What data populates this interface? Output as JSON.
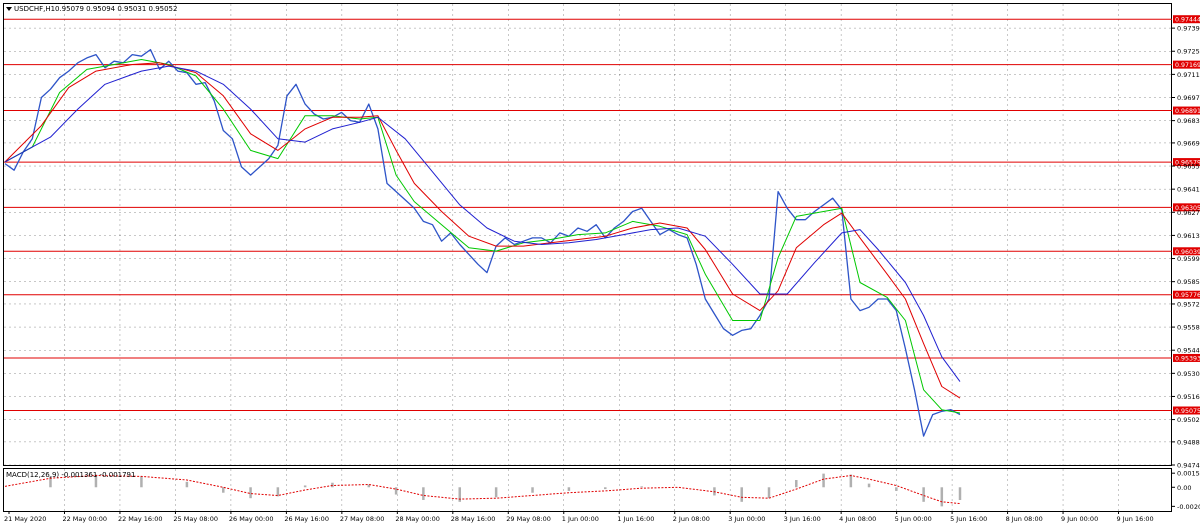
{
  "header": {
    "symbol_text": "USDCHF,H1",
    "ohlc_text": "0.95079 0.95094 0.95031 0.95052"
  },
  "macd": {
    "label_text": "MACD(12,26,9) -0.001361 -0.001791",
    "ticks": [
      "0.001547",
      "0.00",
      "-0.002058"
    ]
  },
  "colors": {
    "background": "#ffffff",
    "grid": "#000000",
    "price": "#2e54c8",
    "ma_green": "#00c800",
    "ma_red": "#e00000",
    "ma_blue": "#2020d0",
    "level_line": "#e00000",
    "level_label_bg": "#e00000",
    "macd_hist": "#b0b0b0",
    "macd_signal": "#e00000"
  },
  "chart_data": {
    "type": "line",
    "title": "USDCHF,H1",
    "price_ticks": [
      "0.97390",
      "0.97250",
      "0.97110",
      "0.96970",
      "0.96830",
      "0.96695",
      "0.96555",
      "0.96415",
      "0.96275",
      "0.96135",
      "0.95995",
      "0.95855",
      "0.95720",
      "0.95580",
      "0.95440",
      "0.95300",
      "0.95160",
      "0.95020",
      "0.94885",
      "0.94745"
    ],
    "ylim": [
      0.94745,
      0.9753
    ],
    "x_labels": [
      "21 May 2020",
      "22 May 00:00",
      "22 May 16:00",
      "25 May 08:00",
      "26 May 00:00",
      "26 May 16:00",
      "27 May 08:00",
      "28 May 00:00",
      "28 May 16:00",
      "29 May 08:00",
      "1 Jun 00:00",
      "1 Jun 16:00",
      "2 Jun 08:00",
      "3 Jun 00:00",
      "3 Jun 16:00",
      "4 Jun 08:00",
      "5 Jun 00:00",
      "5 Jun 16:00",
      "8 Jun 08:00",
      "9 Jun 00:00",
      "9 Jun 16:00"
    ],
    "levels": [
      0.97444,
      0.97169,
      0.96891,
      0.96579,
      0.96305,
      0.96039,
      0.95776,
      0.95393,
      0.95075
    ],
    "current_price": "0.95052",
    "x_end": 210,
    "series": [
      {
        "key": "price",
        "values": [
          [
            0,
            0.9657
          ],
          [
            2,
            0.9653
          ],
          [
            4,
            0.9664
          ],
          [
            6,
            0.9672
          ],
          [
            8,
            0.9697
          ],
          [
            10,
            0.9702
          ],
          [
            12,
            0.9709
          ],
          [
            14,
            0.9713
          ],
          [
            16,
            0.9718
          ],
          [
            18,
            0.9721
          ],
          [
            20,
            0.9723
          ],
          [
            22,
            0.9715
          ],
          [
            24,
            0.9719
          ],
          [
            26,
            0.9718
          ],
          [
            28,
            0.9723
          ],
          [
            30,
            0.9722
          ],
          [
            32,
            0.9726
          ],
          [
            34,
            0.9714
          ],
          [
            36,
            0.9719
          ],
          [
            38,
            0.9713
          ],
          [
            40,
            0.9712
          ],
          [
            42,
            0.9705
          ],
          [
            44,
            0.9706
          ],
          [
            46,
            0.9695
          ],
          [
            48,
            0.9677
          ],
          [
            50,
            0.9672
          ],
          [
            52,
            0.9655
          ],
          [
            54,
            0.965
          ],
          [
            56,
            0.9655
          ],
          [
            58,
            0.966
          ],
          [
            60,
            0.9668
          ],
          [
            62,
            0.9698
          ],
          [
            64,
            0.9705
          ],
          [
            66,
            0.9693
          ],
          [
            68,
            0.9687
          ],
          [
            70,
            0.9684
          ],
          [
            72,
            0.9685
          ],
          [
            74,
            0.9688
          ],
          [
            76,
            0.9683
          ],
          [
            78,
            0.9682
          ],
          [
            80,
            0.9693
          ],
          [
            82,
            0.9678
          ],
          [
            84,
            0.9645
          ],
          [
            86,
            0.964
          ],
          [
            88,
            0.9635
          ],
          [
            90,
            0.963
          ],
          [
            92,
            0.9622
          ],
          [
            94,
            0.962
          ],
          [
            96,
            0.961
          ],
          [
            98,
            0.9615
          ],
          [
            100,
            0.9608
          ],
          [
            102,
            0.9602
          ],
          [
            104,
            0.9596
          ],
          [
            106,
            0.9591
          ],
          [
            108,
            0.9607
          ],
          [
            110,
            0.9612
          ],
          [
            112,
            0.9608
          ],
          [
            114,
            0.961
          ],
          [
            116,
            0.9612
          ],
          [
            118,
            0.9612
          ],
          [
            120,
            0.9609
          ],
          [
            122,
            0.9615
          ],
          [
            124,
            0.9613
          ],
          [
            126,
            0.9618
          ],
          [
            128,
            0.9616
          ],
          [
            130,
            0.962
          ],
          [
            132,
            0.9612
          ],
          [
            134,
            0.9618
          ],
          [
            136,
            0.9622
          ],
          [
            138,
            0.9628
          ],
          [
            140,
            0.963
          ],
          [
            142,
            0.9622
          ],
          [
            144,
            0.9614
          ],
          [
            146,
            0.9617
          ],
          [
            148,
            0.9614
          ],
          [
            150,
            0.9612
          ],
          [
            152,
            0.9596
          ],
          [
            154,
            0.9575
          ],
          [
            156,
            0.9566
          ],
          [
            158,
            0.9557
          ],
          [
            160,
            0.9553
          ],
          [
            162,
            0.9556
          ],
          [
            164,
            0.9557
          ],
          [
            166,
            0.9565
          ],
          [
            168,
            0.9575
          ],
          [
            170,
            0.964
          ],
          [
            172,
            0.963
          ],
          [
            174,
            0.9623
          ],
          [
            176,
            0.9623
          ],
          [
            178,
            0.9628
          ],
          [
            180,
            0.9632
          ],
          [
            182,
            0.9636
          ],
          [
            184,
            0.9629
          ],
          [
            186,
            0.9575
          ],
          [
            188,
            0.9568
          ],
          [
            190,
            0.957
          ],
          [
            192,
            0.9575
          ],
          [
            194,
            0.9575
          ],
          [
            196,
            0.9568
          ],
          [
            198,
            0.9545
          ],
          [
            200,
            0.952
          ],
          [
            202,
            0.9492
          ],
          [
            204,
            0.9505
          ],
          [
            206,
            0.9507
          ],
          [
            208,
            0.9508
          ],
          [
            210,
            0.9505
          ]
        ]
      },
      {
        "key": "ma_green",
        "values": [
          [
            0,
            0.9658
          ],
          [
            6,
            0.9667
          ],
          [
            12,
            0.97
          ],
          [
            18,
            0.9714
          ],
          [
            24,
            0.9717
          ],
          [
            30,
            0.972
          ],
          [
            36,
            0.9717
          ],
          [
            42,
            0.971
          ],
          [
            48,
            0.969
          ],
          [
            54,
            0.9665
          ],
          [
            60,
            0.966
          ],
          [
            66,
            0.9686
          ],
          [
            72,
            0.9686
          ],
          [
            78,
            0.9684
          ],
          [
            82,
            0.9685
          ],
          [
            86,
            0.965
          ],
          [
            90,
            0.9634
          ],
          [
            96,
            0.962
          ],
          [
            102,
            0.9606
          ],
          [
            108,
            0.9604
          ],
          [
            114,
            0.9609
          ],
          [
            120,
            0.9611
          ],
          [
            126,
            0.9614
          ],
          [
            132,
            0.9615
          ],
          [
            138,
            0.9622
          ],
          [
            144,
            0.9619
          ],
          [
            150,
            0.9614
          ],
          [
            154,
            0.959
          ],
          [
            160,
            0.9562
          ],
          [
            166,
            0.9562
          ],
          [
            170,
            0.96
          ],
          [
            174,
            0.9625
          ],
          [
            180,
            0.9628
          ],
          [
            184,
            0.963
          ],
          [
            188,
            0.9585
          ],
          [
            194,
            0.9576
          ],
          [
            198,
            0.9562
          ],
          [
            202,
            0.952
          ],
          [
            206,
            0.9508
          ],
          [
            210,
            0.9506
          ]
        ]
      },
      {
        "key": "ma_red",
        "values": [
          [
            0,
            0.9658
          ],
          [
            8,
            0.968
          ],
          [
            14,
            0.9703
          ],
          [
            20,
            0.9713
          ],
          [
            28,
            0.9717
          ],
          [
            34,
            0.9718
          ],
          [
            42,
            0.9712
          ],
          [
            48,
            0.9698
          ],
          [
            54,
            0.9675
          ],
          [
            60,
            0.9665
          ],
          [
            66,
            0.9678
          ],
          [
            72,
            0.9685
          ],
          [
            78,
            0.9685
          ],
          [
            82,
            0.9686
          ],
          [
            86,
            0.9665
          ],
          [
            90,
            0.9645
          ],
          [
            96,
            0.9628
          ],
          [
            102,
            0.9613
          ],
          [
            108,
            0.9607
          ],
          [
            114,
            0.9607
          ],
          [
            120,
            0.9609
          ],
          [
            126,
            0.9611
          ],
          [
            132,
            0.9613
          ],
          [
            138,
            0.9618
          ],
          [
            144,
            0.9621
          ],
          [
            150,
            0.9618
          ],
          [
            154,
            0.9605
          ],
          [
            160,
            0.9578
          ],
          [
            166,
            0.9568
          ],
          [
            170,
            0.958
          ],
          [
            174,
            0.9606
          ],
          [
            180,
            0.962
          ],
          [
            184,
            0.9627
          ],
          [
            188,
            0.9612
          ],
          [
            194,
            0.959
          ],
          [
            198,
            0.9575
          ],
          [
            202,
            0.9548
          ],
          [
            206,
            0.9522
          ],
          [
            210,
            0.9515
          ]
        ]
      },
      {
        "key": "ma_blue",
        "values": [
          [
            0,
            0.9658
          ],
          [
            10,
            0.9673
          ],
          [
            16,
            0.969
          ],
          [
            22,
            0.9705
          ],
          [
            30,
            0.9713
          ],
          [
            36,
            0.9716
          ],
          [
            42,
            0.9713
          ],
          [
            48,
            0.9705
          ],
          [
            54,
            0.969
          ],
          [
            60,
            0.9672
          ],
          [
            66,
            0.967
          ],
          [
            72,
            0.9678
          ],
          [
            78,
            0.9682
          ],
          [
            82,
            0.9685
          ],
          [
            88,
            0.9672
          ],
          [
            94,
            0.9652
          ],
          [
            100,
            0.9632
          ],
          [
            106,
            0.9618
          ],
          [
            112,
            0.961
          ],
          [
            118,
            0.9608
          ],
          [
            124,
            0.9609
          ],
          [
            130,
            0.9611
          ],
          [
            136,
            0.9614
          ],
          [
            142,
            0.9617
          ],
          [
            148,
            0.9618
          ],
          [
            154,
            0.9613
          ],
          [
            160,
            0.9596
          ],
          [
            166,
            0.9578
          ],
          [
            172,
            0.9578
          ],
          [
            178,
            0.9597
          ],
          [
            184,
            0.9615
          ],
          [
            188,
            0.9617
          ],
          [
            192,
            0.9605
          ],
          [
            198,
            0.9585
          ],
          [
            202,
            0.9565
          ],
          [
            206,
            0.954
          ],
          [
            210,
            0.9525
          ]
        ]
      }
    ],
    "macd_hist": [
      [
        0,
        0.0
      ],
      [
        10,
        0.0012
      ],
      [
        20,
        0.0014
      ],
      [
        30,
        0.0012
      ],
      [
        40,
        0.0006
      ],
      [
        48,
        -0.0006
      ],
      [
        54,
        -0.0012
      ],
      [
        60,
        -0.001
      ],
      [
        66,
        0.0002
      ],
      [
        72,
        0.0005
      ],
      [
        80,
        0.0003
      ],
      [
        86,
        -0.0008
      ],
      [
        92,
        -0.0014
      ],
      [
        100,
        -0.0016
      ],
      [
        108,
        -0.0011
      ],
      [
        116,
        -0.0006
      ],
      [
        124,
        -0.0004
      ],
      [
        132,
        -0.0002
      ],
      [
        140,
        0.0001
      ],
      [
        148,
        0.0
      ],
      [
        156,
        -0.0009
      ],
      [
        162,
        -0.0016
      ],
      [
        168,
        -0.0012
      ],
      [
        174,
        0.0008
      ],
      [
        180,
        0.0015
      ],
      [
        186,
        0.0014
      ],
      [
        190,
        0.0004
      ],
      [
        196,
        -0.0004
      ],
      [
        202,
        -0.0016
      ],
      [
        206,
        -0.0021
      ],
      [
        210,
        -0.0014
      ]
    ],
    "macd_signal": [
      [
        0,
        0.0001
      ],
      [
        10,
        0.001
      ],
      [
        20,
        0.0013
      ],
      [
        30,
        0.0012
      ],
      [
        40,
        0.0008
      ],
      [
        48,
        0.0
      ],
      [
        54,
        -0.0007
      ],
      [
        60,
        -0.0009
      ],
      [
        66,
        -0.0003
      ],
      [
        72,
        0.0002
      ],
      [
        80,
        0.0003
      ],
      [
        86,
        -0.0002
      ],
      [
        92,
        -0.0009
      ],
      [
        100,
        -0.0013
      ],
      [
        108,
        -0.0012
      ],
      [
        116,
        -0.0009
      ],
      [
        124,
        -0.0006
      ],
      [
        132,
        -0.0004
      ],
      [
        140,
        -0.0001
      ],
      [
        148,
        0.0
      ],
      [
        156,
        -0.0005
      ],
      [
        162,
        -0.0011
      ],
      [
        168,
        -0.0012
      ],
      [
        174,
        -0.0002
      ],
      [
        180,
        0.0009
      ],
      [
        186,
        0.0013
      ],
      [
        190,
        0.0009
      ],
      [
        196,
        0.0002
      ],
      [
        202,
        -0.0009
      ],
      [
        206,
        -0.0016
      ],
      [
        210,
        -0.0018
      ]
    ],
    "macd_ylim": [
      -0.0025,
      0.0019
    ]
  }
}
